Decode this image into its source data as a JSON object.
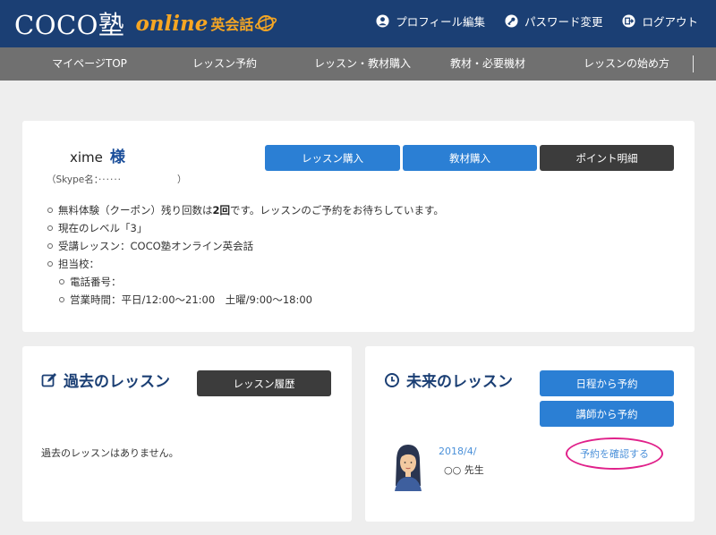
{
  "header": {
    "logo_main": "COCO塾",
    "logo_online": "online",
    "logo_eikaiwa": "英会話",
    "links": [
      {
        "label": "プロフィール編集",
        "icon": "user-icon"
      },
      {
        "label": "パスワード変更",
        "icon": "key-icon"
      },
      {
        "label": "ログアウト",
        "icon": "logout-icon"
      }
    ]
  },
  "nav": {
    "items": [
      "マイページTOP",
      "レッスン予約",
      "レッスン・教材購入",
      "教材・必要機材",
      "レッスンの始め方"
    ]
  },
  "profile": {
    "username": "xime",
    "honorific": "様",
    "skype_prefix": "（Skype名：",
    "skype_value": "······",
    "skype_suffix": "）",
    "buttons": {
      "lesson_purchase": "レッスン購入",
      "material_purchase": "教材購入",
      "point_details": "ポイント明細"
    },
    "info": {
      "coupon_pre": "無料体験（クーポン）残り回数は",
      "coupon_count": "2回",
      "coupon_post": "です。レッスンのご予約をお待ちしています。",
      "level": "現在のレベル「3」",
      "course": "受講レッスン：COCO塾オンライン英会話",
      "school": "担当校：",
      "phone": "電話番号：",
      "hours": "営業時間：平日/12:00〜21:00　土曜/9:00〜18:00"
    }
  },
  "past": {
    "title": "過去のレッスン",
    "history_button": "レッスン履歴",
    "empty_message": "過去のレッスンはありません。"
  },
  "future": {
    "title": "未来のレッスン",
    "by_date_button": "日程から予約",
    "by_teacher_button": "講師から予約",
    "lesson_date": "2018/4/",
    "lesson_teacher": "○○ 先生",
    "confirm_link": "予約を確認する"
  },
  "colors": {
    "header_bg": "#1b3f74",
    "nav_bg": "#707070",
    "accent_orange": "#f6a623",
    "button_blue": "#2b7fd4",
    "button_dark": "#3c3c3c",
    "highlight_pink": "#e0218a"
  }
}
